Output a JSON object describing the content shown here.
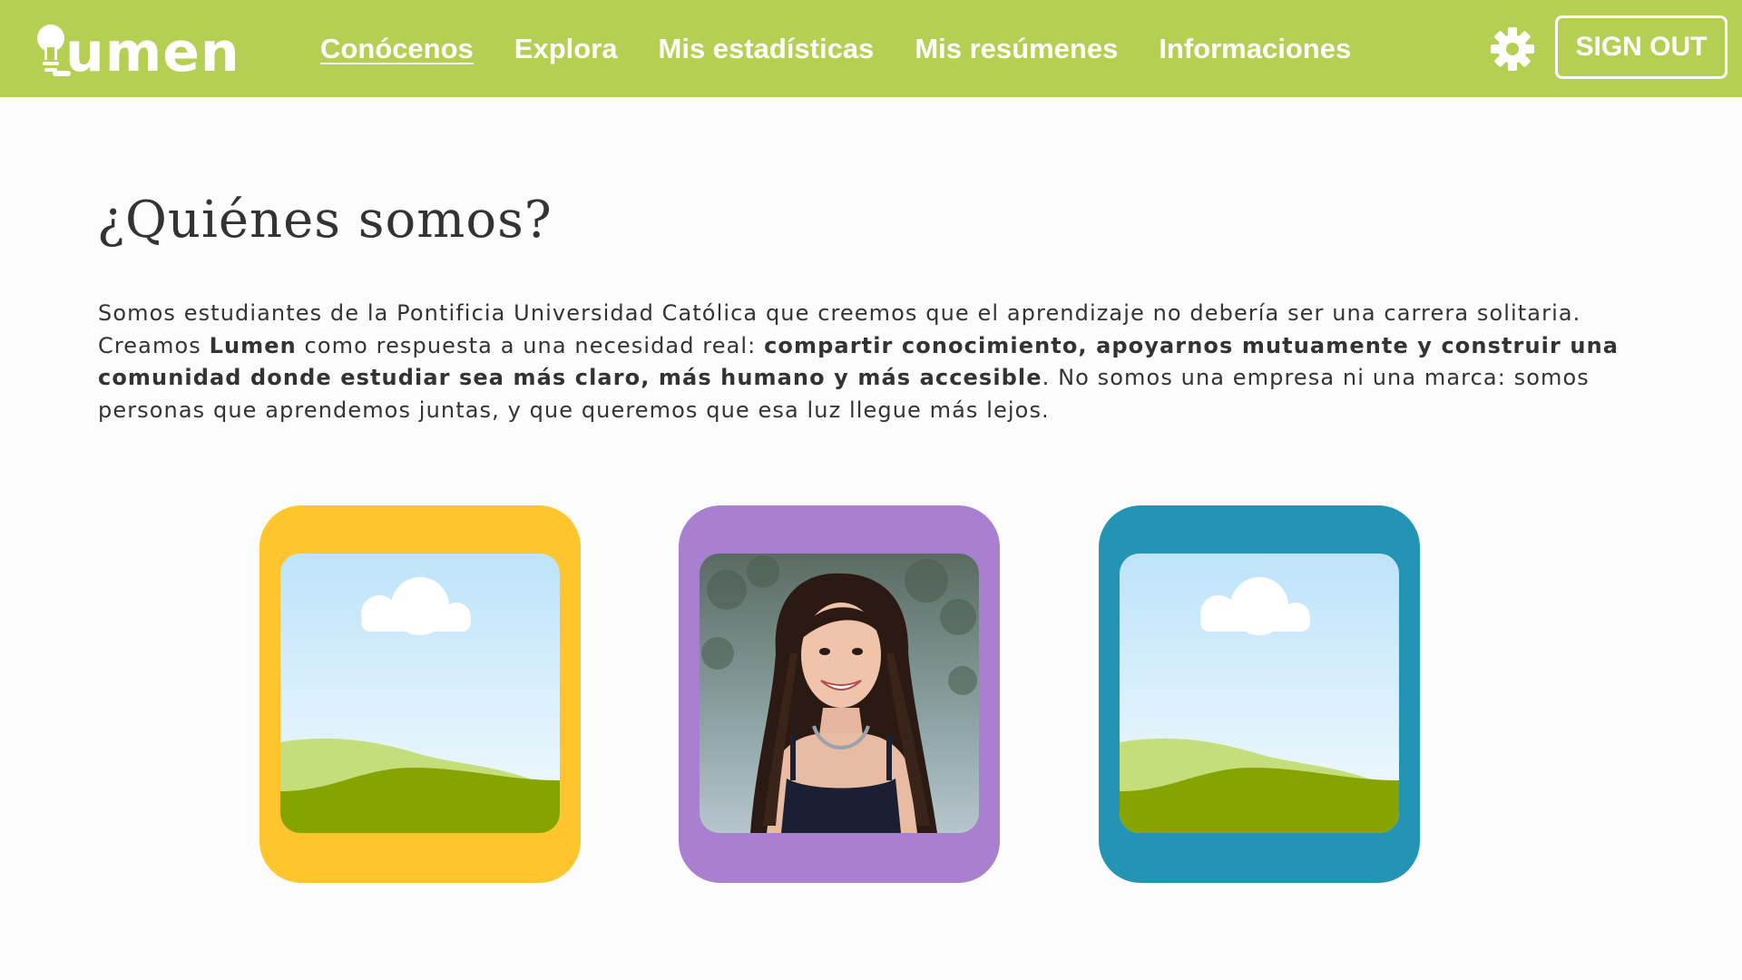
{
  "brand": {
    "name": "umen",
    "full_name": "Lumen"
  },
  "nav": {
    "items": [
      {
        "label": "Conócenos",
        "active": true
      },
      {
        "label": "Explora",
        "active": false
      },
      {
        "label": "Mis estadísticas",
        "active": false
      },
      {
        "label": "Mis resúmenes",
        "active": false
      },
      {
        "label": "Informaciones",
        "active": false
      }
    ],
    "settings_icon": "gear-icon",
    "sign_out_label": "SIGN OUT"
  },
  "main": {
    "title": "¿Quiénes somos?",
    "intro": {
      "part1": "Somos estudiantes de la Pontificia Universidad Católica que creemos que el aprendizaje no debería ser una carrera solitaria. Creamos ",
      "bold1": "Lumen",
      "part2": " como respuesta a una necesidad real: ",
      "bold2": "compartir conocimiento, apoyarnos mutuamente y construir una comunidad donde estudiar sea más claro, más humano y más accesible",
      "part3": ". No somos una empresa ni una marca: somos personas que aprendemos juntas, y que queremos que esa luz llegue más lejos."
    },
    "team_cards": [
      {
        "photo": "placeholder-landscape-icon",
        "color": "#fec62c"
      },
      {
        "photo": "team-member-photo",
        "color": "#a97fd0"
      },
      {
        "photo": "placeholder-landscape-icon",
        "color": "#2494b4"
      }
    ]
  },
  "colors": {
    "header": "#b5cf52",
    "background": "#fcfcfc",
    "text": "#333333"
  }
}
